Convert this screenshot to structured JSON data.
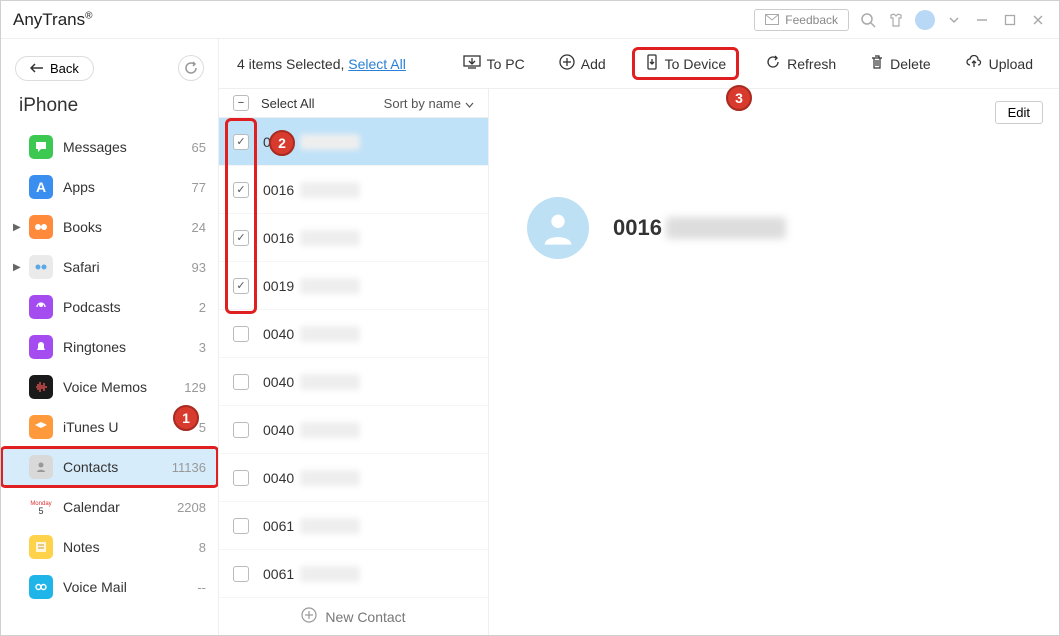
{
  "app_title": "AnyTrans",
  "titlebar": {
    "feedback": "Feedback"
  },
  "sidebar": {
    "back": "Back",
    "device": "iPhone",
    "items": [
      {
        "label": "Messages",
        "count": "65",
        "color": "#3dc951",
        "icon": "bubble"
      },
      {
        "label": "Apps",
        "count": "77",
        "color": "#3a8ef0",
        "icon": "A"
      },
      {
        "label": "Books",
        "count": "24",
        "color": "#ff8a3c",
        "icon": "books",
        "arrow": true
      },
      {
        "label": "Safari",
        "count": "93",
        "color": "#eaeaea",
        "icon": "safari",
        "arrow": true
      },
      {
        "label": "Podcasts",
        "count": "2",
        "color": "#a44cf0",
        "icon": "podcast"
      },
      {
        "label": "Ringtones",
        "count": "3",
        "color": "#a44cf0",
        "icon": "bell"
      },
      {
        "label": "Voice Memos",
        "count": "129",
        "color": "#1a1a1a",
        "icon": "wave"
      },
      {
        "label": "iTunes U",
        "count": "5",
        "color": "#ff9a3c",
        "icon": "cap"
      },
      {
        "label": "Contacts",
        "count": "11136",
        "color": "#d9d9d9",
        "icon": "contacts",
        "active": true,
        "highlighted": true
      },
      {
        "label": "Calendar",
        "count": "2208",
        "color": "#ffffff",
        "icon": "cal"
      },
      {
        "label": "Notes",
        "count": "8",
        "color": "#ffd24c",
        "icon": "notes"
      },
      {
        "label": "Voice Mail",
        "count": "--",
        "color": "#1fb5e8",
        "icon": "vmail"
      }
    ]
  },
  "toolbar": {
    "selection": "4 items Selected, ",
    "select_all_link": "Select All",
    "actions": {
      "to_pc": "To PC",
      "add": "Add",
      "to_device": "To Device",
      "refresh": "Refresh",
      "delete": "Delete",
      "upload": "Upload"
    }
  },
  "list": {
    "select_all": "Select All",
    "sort": "Sort by name",
    "rows": [
      {
        "name": "0016",
        "checked": true,
        "selected": true
      },
      {
        "name": "0016",
        "checked": true
      },
      {
        "name": "0016",
        "checked": true
      },
      {
        "name": "0019",
        "checked": true
      },
      {
        "name": "0040",
        "checked": false
      },
      {
        "name": "0040",
        "checked": false
      },
      {
        "name": "0040",
        "checked": false
      },
      {
        "name": "0040",
        "checked": false
      },
      {
        "name": "0061",
        "checked": false
      },
      {
        "name": "0061",
        "checked": false
      }
    ],
    "new_contact": "New Contact"
  },
  "detail": {
    "edit": "Edit",
    "name": "0016"
  },
  "annotations": {
    "b1": "1",
    "b2": "2",
    "b3": "3"
  }
}
